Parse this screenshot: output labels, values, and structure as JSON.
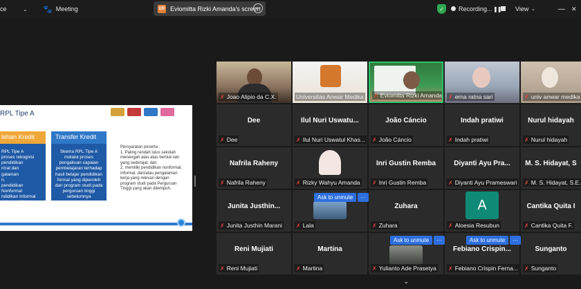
{
  "topbar": {
    "app_name": "ce",
    "meeting_label": "Meeting",
    "share_badge": "ER",
    "share_title": "Eviomitta Rizki Amanda's screen",
    "recording_label": "Recording...",
    "view_label": "View",
    "minimize_glyph": "—",
    "close_glyph": "✕"
  },
  "slide": {
    "title": "RPL Tipe A",
    "col1_header": "lehan Kredit",
    "col1_body": "RPL Tipe A\nproses rekognisi\npendidikan\nrmal dan\ngalaman\nn.\npendidikan Nonformal\nndidikan Informal\ngalaman Kerja",
    "col2_header": "Transfer Kredit",
    "col2_body": "Skema RPL Tipe A melalui proses pengakuan capaian pembelajaran terhadap hasil belajar pendidikan formal yang diperoleh dari program studi pada perguruan tinggi sebelumnya",
    "requirements": "Persyaratan peserta :\n1. Paling rendah lulus sekolah menengah atas atau bentuk lain yang sederajat; dan\n2. memiliki pendidikan nonformal, informal, dan/atau pengalaman kerja yang relevan dengan program studi pada Perguruan Tinggi yang akan ditempuh."
  },
  "participants": {
    "row1": [
      {
        "name": "Joao Alipio da C.X.",
        "display": ""
      },
      {
        "name": "Universitas Anwar Medika",
        "display": ""
      },
      {
        "name": "Eviomitta Rizki Amanda",
        "display": ""
      },
      {
        "name": "erna ratna sari",
        "display": ""
      },
      {
        "name": "univ anwar medika",
        "display": ""
      }
    ],
    "row2": [
      {
        "name": "Dee",
        "display": "Dee"
      },
      {
        "name": "Ilul Nuri Uswatul Khas...",
        "display": "Ilul Nuri Uswatu..."
      },
      {
        "name": "João Cáncio",
        "display": "João Cáncio"
      },
      {
        "name": "Indah pratiwi",
        "display": "Indah pratiwi"
      },
      {
        "name": "Nurul hidayah",
        "display": "Nurul hidayah"
      }
    ],
    "row3": [
      {
        "name": "Nafrila Raheny",
        "display": "Nafrila Raheny"
      },
      {
        "name": "Rizky Wahyu Amanda",
        "display": ""
      },
      {
        "name": "Inri Gustin Remba",
        "display": "Inri Gustin Remba"
      },
      {
        "name": "Diyanti Ayu Prameswari",
        "display": "Diyanti Ayu Pra..."
      },
      {
        "name": "M. S. Hidayat, S.E.",
        "display": "M. S. Hidayat, S"
      }
    ],
    "row4": [
      {
        "name": "Junita Justhin Marani",
        "display": "Junita Justhin..."
      },
      {
        "name": "Lala",
        "display": ""
      },
      {
        "name": "Zuhara",
        "display": "Zuhara"
      },
      {
        "name": "Aloesia Resubun",
        "display": "A"
      },
      {
        "name": "Cantika Quita F.",
        "display": "Cantika Quita I"
      }
    ],
    "row5": [
      {
        "name": "Reni Mujiati",
        "display": "Reni Mujiati"
      },
      {
        "name": "Martina",
        "display": "Martina"
      },
      {
        "name": "Yulianto Ade Prasetya",
        "display": ""
      },
      {
        "name": "Febiano Crispin Ferna...",
        "display": "Febiano Crispin..."
      },
      {
        "name": "Sunganto",
        "display": "Sunganto"
      }
    ],
    "unmute_label": "Ask to unmute",
    "unmute_more": "···"
  }
}
